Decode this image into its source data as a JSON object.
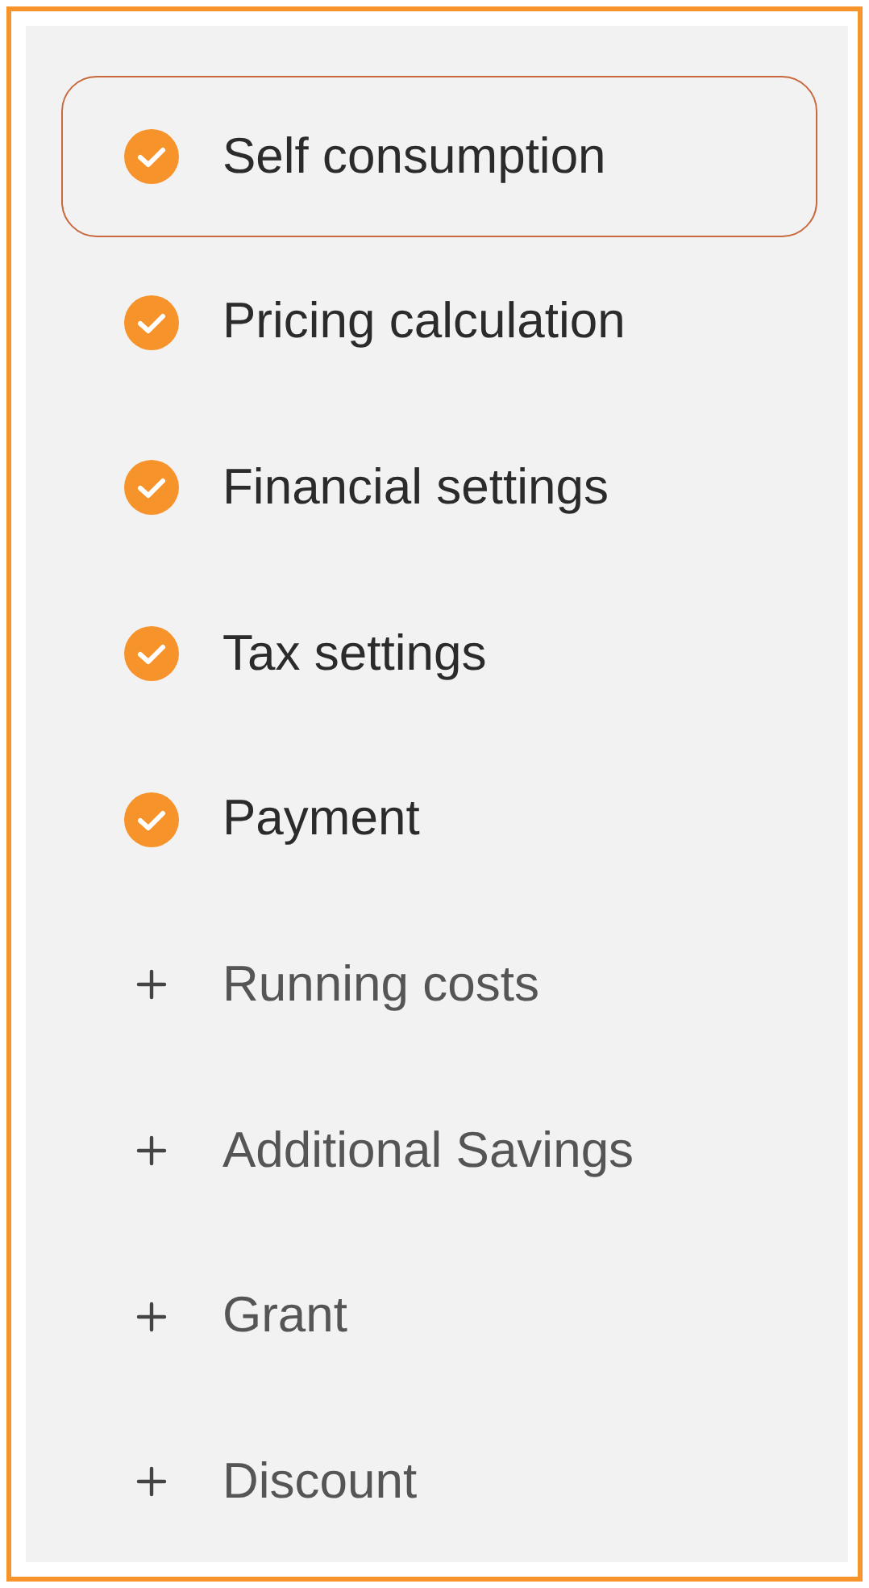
{
  "steps": [
    {
      "label": "Self consumption",
      "kind": "done",
      "selected": true
    },
    {
      "label": "Pricing calculation",
      "kind": "done",
      "selected": false
    },
    {
      "label": "Financial settings",
      "kind": "done",
      "selected": false
    },
    {
      "label": "Tax settings",
      "kind": "done",
      "selected": false
    },
    {
      "label": "Payment",
      "kind": "done",
      "selected": false
    },
    {
      "label": "Running costs",
      "kind": "add",
      "selected": false
    },
    {
      "label": "Additional Savings",
      "kind": "add",
      "selected": false
    },
    {
      "label": "Grant",
      "kind": "add",
      "selected": false
    },
    {
      "label": "Discount",
      "kind": "add",
      "selected": false
    }
  ]
}
